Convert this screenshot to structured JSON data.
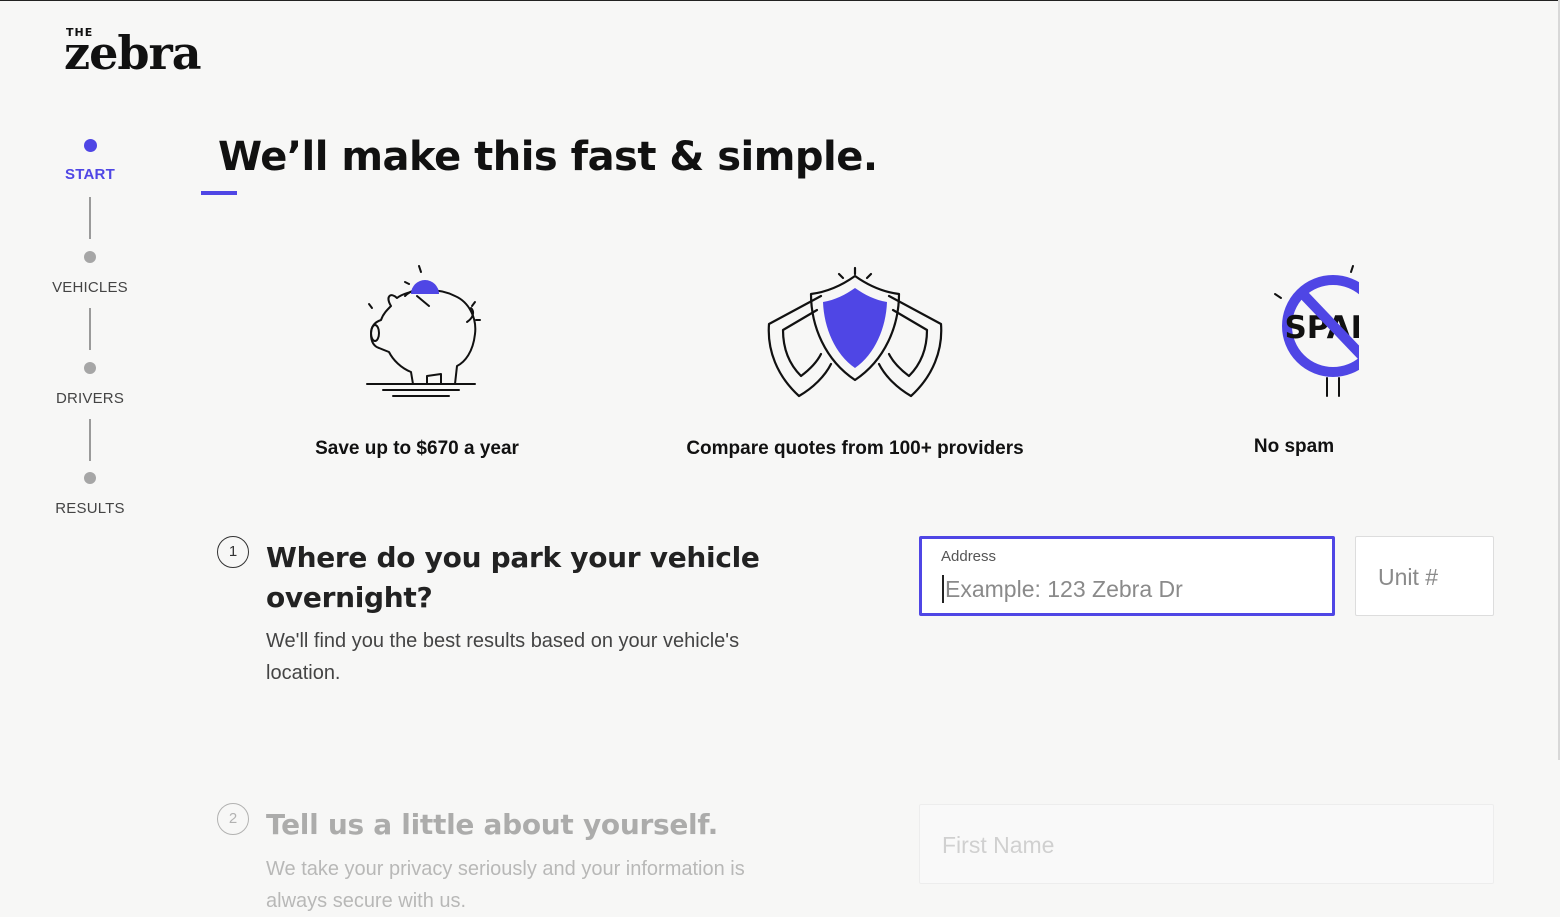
{
  "brand": {
    "small": "THE",
    "name": "zebra"
  },
  "progress": {
    "steps": [
      "START",
      "VEHICLES",
      "DRIVERS",
      "RESULTS"
    ],
    "active": "START"
  },
  "headline": "We’ll make this fast & simple.",
  "features": [
    {
      "icon": "piggy-bank-icon",
      "caption": "Save up to $670 a year"
    },
    {
      "icon": "shield-icon",
      "caption": "Compare quotes from 100+ providers"
    },
    {
      "icon": "no-spam-icon",
      "caption": "No spam",
      "icon_text": "SPAM"
    }
  ],
  "question1": {
    "number": "1",
    "title_line1": "Where do you park your vehicle",
    "title_line2": "overnight?",
    "subtitle_line1": "We'll find you the best results based on your vehicle's",
    "subtitle_line2": "location.",
    "address_label": "Address",
    "address_placeholder": "Example: 123 Zebra Dr",
    "unit_placeholder": "Unit #"
  },
  "question2": {
    "number": "2",
    "title": "Tell us a little about yourself.",
    "subtitle_line1": "We take your privacy seriously and your information is",
    "subtitle_line2": "always secure with us.",
    "first_name_placeholder": "First Name"
  },
  "colors": {
    "accent": "#4f46e5",
    "background": "#f7f7f6",
    "text": "#111111"
  }
}
